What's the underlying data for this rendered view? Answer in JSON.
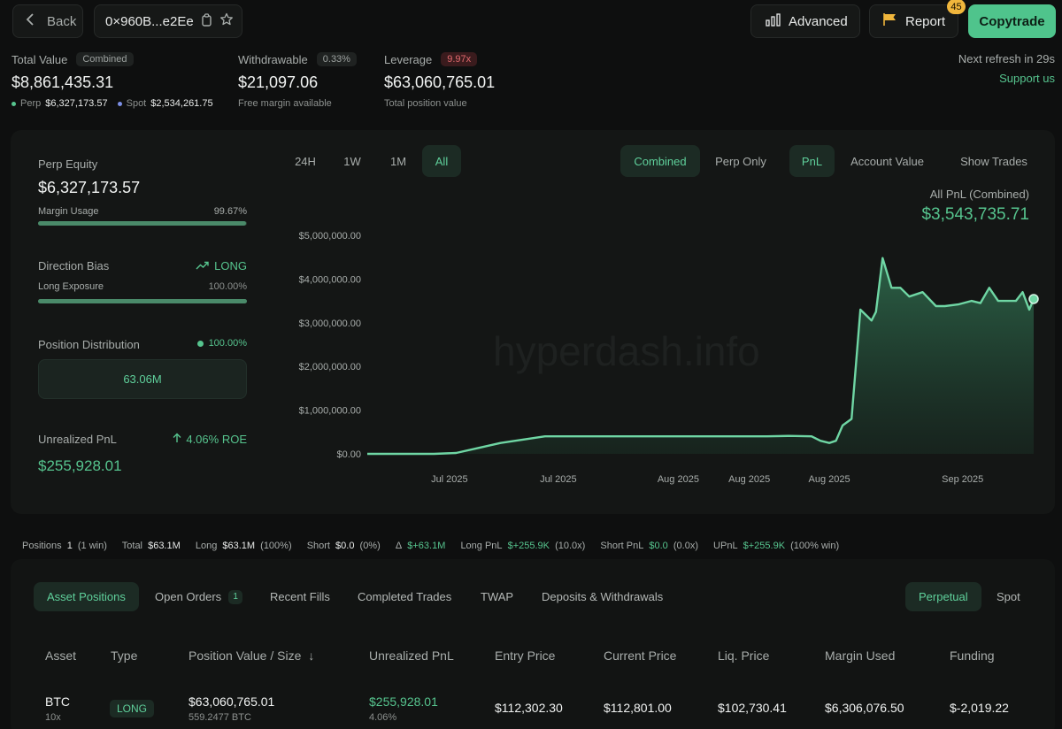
{
  "topbar": {
    "back_label": "Back",
    "address": "0×960B...e2Ee",
    "advanced_label": "Advanced",
    "report_label": "Report",
    "report_badge": "45",
    "copytrade_label": "Copytrade",
    "refresh_text": "Next refresh in 29s",
    "support_label": "Support us"
  },
  "stats": {
    "total_value_label": "Total Value",
    "total_value_pill": "Combined",
    "total_value": "$8,861,435.31",
    "perp_label": "Perp",
    "perp_value": "$6,327,173.57",
    "spot_label": "Spot",
    "spot_value": "$2,534,261.75",
    "withdrawable_label": "Withdrawable",
    "withdrawable_pill": "0.33%",
    "withdrawable_value": "$21,097.06",
    "withdrawable_sub": "Free margin available",
    "leverage_label": "Leverage",
    "leverage_pill": "9.97x",
    "leverage_value": "$63,060,765.01",
    "leverage_sub": "Total position value"
  },
  "left": {
    "perp_equity_label": "Perp Equity",
    "perp_equity_value": "$6,327,173.57",
    "margin_usage_label": "Margin Usage",
    "margin_usage_value": "99.67%",
    "margin_usage_fraction": 0.9967,
    "direction_bias_label": "Direction Bias",
    "direction_bias_value": "LONG",
    "long_exposure_label": "Long Exposure",
    "long_exposure_value": "100.00%",
    "long_exposure_fraction": 1.0,
    "position_distribution_label": "Position Distribution",
    "position_distribution_value": "100.00%",
    "position_block_label": "63.06M",
    "unrealized_pnl_label": "Unrealized PnL",
    "roe_value": "4.06% ROE",
    "unrealized_pnl_value": "$255,928.01"
  },
  "controls": {
    "ranges": [
      "24H",
      "1W",
      "1M",
      "All"
    ],
    "active_range": "All",
    "mode_combined": "Combined",
    "mode_perp_only": "Perp Only",
    "metric_pnl": "PnL",
    "metric_account_value": "Account Value",
    "show_trades": "Show Trades"
  },
  "chart_header": {
    "caption": "All PnL (Combined)",
    "value": "$3,543,735.71",
    "watermark": "hyperdash.info"
  },
  "chart_data": {
    "type": "area",
    "y_ticks": [
      "$5,000,000.00",
      "$4,000,000.00",
      "$3,000,000.00",
      "$2,000,000.00",
      "$1,000,000.00",
      "$0.00"
    ],
    "ylim": [
      0,
      5000000
    ],
    "x_ticks": [
      "Jul 2025",
      "Jul 2025",
      "Aug 2025",
      "Aug 2025",
      "Aug 2025",
      "Sep 2025"
    ],
    "x_tick_positions": [
      0.185,
      0.43,
      0.7,
      0.86,
      1.04,
      1.34
    ],
    "xlim": [
      0,
      1.5
    ],
    "line_color": "#6fd6a4",
    "series": [
      {
        "x": [
          0.0,
          0.15,
          0.2,
          0.3,
          0.4,
          0.5,
          0.6,
          0.7,
          0.8,
          0.9,
          0.95,
          1.0,
          1.02,
          1.04,
          1.055,
          1.07,
          1.09,
          1.11,
          1.125,
          1.135,
          1.145,
          1.16,
          1.18,
          1.2,
          1.22,
          1.25,
          1.28,
          1.3,
          1.33,
          1.36,
          1.38,
          1.4,
          1.42,
          1.44,
          1.46,
          1.475,
          1.49,
          1.5
        ],
        "y": [
          0,
          0,
          20000,
          250000,
          400000,
          400000,
          400000,
          400000,
          400000,
          400000,
          410000,
          400000,
          300000,
          250000,
          300000,
          650000,
          800000,
          3300000,
          3150000,
          3050000,
          3250000,
          4480000,
          3800000,
          3800000,
          3600000,
          3700000,
          3380000,
          3380000,
          3420000,
          3500000,
          3450000,
          3800000,
          3500000,
          3500000,
          3500000,
          3700000,
          3300000,
          3543735.71
        ]
      }
    ]
  },
  "summary": {
    "positions_label": "Positions",
    "positions_value": "1",
    "positions_win": "(1 win)",
    "total_label": "Total",
    "total_value": "$63.1M",
    "long_label": "Long",
    "long_value": "$63.1M",
    "long_pct": "(100%)",
    "short_label": "Short",
    "short_value": "$0.0",
    "short_pct": "(0%)",
    "delta_label": "Δ",
    "delta_value": "$+63.1M",
    "long_pnl_label": "Long PnL",
    "long_pnl_value": "$+255.9K",
    "long_pnl_x": "(10.0x)",
    "short_pnl_label": "Short PnL",
    "short_pnl_value": "$0.0",
    "short_pnl_x": "(0.0x)",
    "upnl_label": "UPnL",
    "upnl_value": "$+255.9K",
    "upnl_win": "(100% win)"
  },
  "tabs": {
    "asset_positions": "Asset Positions",
    "open_orders": "Open Orders",
    "open_orders_count": "1",
    "recent_fills": "Recent Fills",
    "completed_trades": "Completed Trades",
    "twap": "TWAP",
    "deposits": "Deposits & Withdrawals",
    "perpetual": "Perpetual",
    "spot": "Spot"
  },
  "table": {
    "headers": [
      "Asset",
      "Type",
      "Position Value / Size",
      "Unrealized PnL",
      "Entry Price",
      "Current Price",
      "Liq. Price",
      "Margin Used",
      "Funding"
    ],
    "sort_arrow": "↓",
    "row": {
      "asset": "BTC",
      "leverage": "10x",
      "type": "LONG",
      "position_value": "$63,060,765.01",
      "position_size": "559.2477 BTC",
      "upnl": "$255,928.01",
      "upnl_pct": "4.06%",
      "entry_price": "$112,302.30",
      "current_price": "$112,801.00",
      "liq_price": "$102,730.41",
      "margin_used": "$6,306,076.50",
      "funding": "$-2,019.22"
    }
  }
}
